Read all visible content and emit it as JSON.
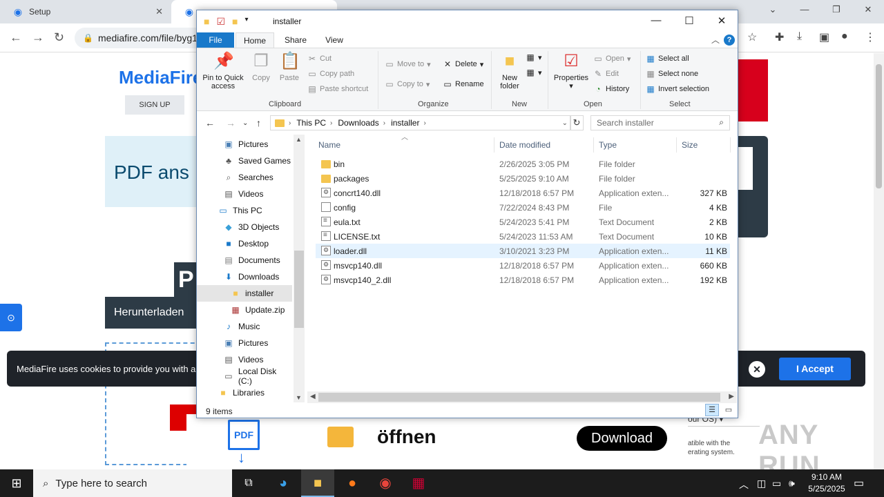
{
  "browser": {
    "tabs": [
      {
        "label": "Setup"
      },
      {
        "label": "M..."
      }
    ],
    "url": "mediafire.com/file/byg1"
  },
  "page": {
    "signup": "SIGN UP",
    "logo": "MediaFire",
    "ad1_text": "PDF ans",
    "ad_dark_text": "Herunterladen",
    "ad_dark2_text": "P",
    "cookie_text": "MediaFire uses cookies to provide you with a",
    "accept_label": "I Accept",
    "oeffnen": "öffnen",
    "download_label": "Download",
    "pdf_label": "PDF",
    "right_sel": "our OS)",
    "right_text_1": "atible with the",
    "right_text_2": "erating system.",
    "watermark": "ANY RUN"
  },
  "explorer": {
    "title": "installer",
    "tabs": {
      "file": "File",
      "home": "Home",
      "share": "Share",
      "view": "View"
    },
    "ribbon": {
      "clipboard": {
        "label": "Clipboard",
        "pin": "Pin to Quick access",
        "copy": "Copy",
        "paste": "Paste",
        "cut": "Cut",
        "copy_path": "Copy path",
        "paste_shortcut": "Paste shortcut"
      },
      "organize": {
        "label": "Organize",
        "move_to": "Move to",
        "copy_to": "Copy to",
        "delete": "Delete",
        "rename": "Rename"
      },
      "new": {
        "label": "New",
        "new_folder": "New folder"
      },
      "open": {
        "label": "Open",
        "properties": "Properties",
        "open": "Open",
        "edit": "Edit",
        "history": "History"
      },
      "select": {
        "label": "Select",
        "select_all": "Select all",
        "select_none": "Select none",
        "invert": "Invert selection"
      }
    },
    "path": [
      "This PC",
      "Downloads",
      "installer"
    ],
    "search_placeholder": "Search installer",
    "tree": [
      {
        "label": "Pictures",
        "icon": "pictures-icon"
      },
      {
        "label": "Saved Games",
        "icon": "saved-games-icon"
      },
      {
        "label": "Searches",
        "icon": "searches-icon"
      },
      {
        "label": "Videos",
        "icon": "videos-icon"
      },
      {
        "label": "This PC",
        "icon": "this-pc-icon"
      },
      {
        "label": "3D Objects",
        "icon": "3d-objects-icon"
      },
      {
        "label": "Desktop",
        "icon": "desktop-icon"
      },
      {
        "label": "Documents",
        "icon": "documents-icon"
      },
      {
        "label": "Downloads",
        "icon": "downloads-icon"
      },
      {
        "label": "installer",
        "icon": "folder-icon"
      },
      {
        "label": "Update.zip",
        "icon": "zip-icon"
      },
      {
        "label": "Music",
        "icon": "music-icon"
      },
      {
        "label": "Pictures",
        "icon": "pictures-icon"
      },
      {
        "label": "Videos",
        "icon": "videos-icon"
      },
      {
        "label": "Local Disk (C:)",
        "icon": "disk-icon"
      },
      {
        "label": "Libraries",
        "icon": "libraries-icon"
      }
    ],
    "columns": {
      "name": "Name",
      "date": "Date modified",
      "type": "Type",
      "size": "Size"
    },
    "files": [
      {
        "name": "bin",
        "date": "2/26/2025 3:05 PM",
        "type": "File folder",
        "size": "",
        "kind": "folder"
      },
      {
        "name": "packages",
        "date": "5/25/2025 9:10 AM",
        "type": "File folder",
        "size": "",
        "kind": "folder"
      },
      {
        "name": "concrt140.dll",
        "date": "12/18/2018 6:57 PM",
        "type": "Application exten...",
        "size": "327 KB",
        "kind": "dll"
      },
      {
        "name": "config",
        "date": "7/22/2024 8:43 PM",
        "type": "File",
        "size": "4 KB",
        "kind": "file"
      },
      {
        "name": "eula.txt",
        "date": "5/24/2023 5:41 PM",
        "type": "Text Document",
        "size": "2 KB",
        "kind": "txt"
      },
      {
        "name": "LICENSE.txt",
        "date": "5/24/2023 11:53 AM",
        "type": "Text Document",
        "size": "10 KB",
        "kind": "txt"
      },
      {
        "name": "loader.dll",
        "date": "3/10/2021 3:23 PM",
        "type": "Application exten...",
        "size": "11 KB",
        "kind": "dll",
        "selected": true
      },
      {
        "name": "msvcp140.dll",
        "date": "12/18/2018 6:57 PM",
        "type": "Application exten...",
        "size": "660 KB",
        "kind": "dll"
      },
      {
        "name": "msvcp140_2.dll",
        "date": "12/18/2018 6:57 PM",
        "type": "Application exten...",
        "size": "192 KB",
        "kind": "dll"
      }
    ],
    "status": "9 items"
  },
  "taskbar": {
    "search_placeholder": "Type here to search",
    "time": "9:10 AM",
    "date": "5/25/2025"
  }
}
